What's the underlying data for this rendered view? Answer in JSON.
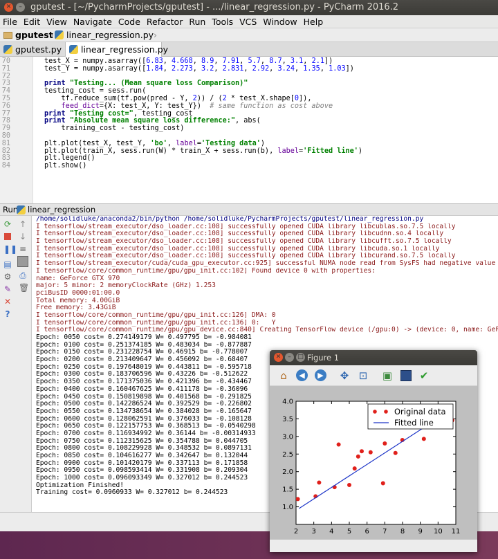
{
  "window": {
    "title": "gputest - [~/PycharmProjects/gputest] - .../linear_regression.py - PyCharm 2016.2"
  },
  "menu": [
    "File",
    "Edit",
    "View",
    "Navigate",
    "Code",
    "Refactor",
    "Run",
    "Tools",
    "VCS",
    "Window",
    "Help"
  ],
  "nav": {
    "project": "gputest",
    "file": "linear_regression.py"
  },
  "tabs": [
    {
      "label": "gputest.py",
      "active": false
    },
    {
      "label": "linear_regression.py",
      "active": true
    }
  ],
  "code_lines": [
    {
      "n": "70",
      "html": "test_X = numpy.asarray([<span class=\"num\">6.83</span>, <span class=\"num\">4.668</span>, <span class=\"num\">8.9</span>, <span class=\"num\">7.91</span>, <span class=\"num\">5.7</span>, <span class=\"num\">8.7</span>, <span class=\"num\">3.1</span>, <span class=\"num\">2.1</span>])"
    },
    {
      "n": "71",
      "html": "test_Y = numpy.asarray([<span class=\"num\">1.84</span>, <span class=\"num\">2.273</span>, <span class=\"num\">3.2</span>, <span class=\"num\">2.831</span>, <span class=\"num\">2.92</span>, <span class=\"num\">3.24</span>, <span class=\"num\">1.35</span>, <span class=\"num\">1.03</span>])"
    },
    {
      "n": "72",
      "html": ""
    },
    {
      "n": "73",
      "html": "<span class=\"kw\">print</span> <span class=\"str\">\"Testing... (Mean square loss Comparison)\"</span>"
    },
    {
      "n": "74",
      "html": "testing_cost = sess.run("
    },
    {
      "n": "75",
      "html": "    tf.reduce_sum(tf.pow(pred - Y, <span class=\"num\">2</span>)) / (<span class=\"num\">2</span> * test_X.shape[<span class=\"num\">0</span>]),"
    },
    {
      "n": "76",
      "html": "    <span class=\"kwarg\">feed_dict</span>={X: test_X, Y: test_Y})  <span class=\"cmt\"># same function as cost above</span>"
    },
    {
      "n": "77",
      "html": "<span class=\"kw\">print</span> <span class=\"str\">\"Testing cost=\"</span>, testing_cost"
    },
    {
      "n": "78",
      "html": "<span class=\"kw\">print</span> <span class=\"str\">\"Absolute mean square loss difference:\"</span>, abs("
    },
    {
      "n": "79",
      "html": "    training_cost - testing_cost)"
    },
    {
      "n": "80",
      "html": ""
    },
    {
      "n": "81",
      "html": "plt.plot(test_X, test_Y, <span class=\"str\">'bo'</span>, <span class=\"kwarg\">label</span>=<span class=\"str\">'Testing data'</span>)"
    },
    {
      "n": "82",
      "html": "plt.plot(train_X, sess.run(W) * train_X + sess.run(b), <span class=\"kwarg\">label</span>=<span class=\"str\">'Fitted line'</span>)"
    },
    {
      "n": "83",
      "html": "plt.legend()"
    },
    {
      "n": "84",
      "html": "plt.show()"
    }
  ],
  "run": {
    "label": "Run",
    "config": "linear_regression"
  },
  "console": [
    {
      "c": "path",
      "t": "/home/solidluke/anaconda2/bin/python /home/solidluke/PycharmProjects/gputest/linear_regression.py"
    },
    {
      "c": "log",
      "t": "I tensorflow/stream_executor/dso_loader.cc:108] successfully opened CUDA library libcublas.so.7.5 locally"
    },
    {
      "c": "log",
      "t": "I tensorflow/stream_executor/dso_loader.cc:108] successfully opened CUDA library libcudnn.so.4 locally"
    },
    {
      "c": "log",
      "t": "I tensorflow/stream_executor/dso_loader.cc:108] successfully opened CUDA library libcufft.so.7.5 locally"
    },
    {
      "c": "log",
      "t": "I tensorflow/stream_executor/dso_loader.cc:108] successfully opened CUDA library libcuda.so.1 locally"
    },
    {
      "c": "log",
      "t": "I tensorflow/stream_executor/dso_loader.cc:108] successfully opened CUDA library libcurand.so.7.5 locally"
    },
    {
      "c": "log",
      "t": "I tensorflow/stream_executor/cuda/cuda_gpu_executor.cc:925] successful NUMA node read from SysFS had negative value (-1), but the"
    },
    {
      "c": "log",
      "t": "I tensorflow/core/common_runtime/gpu/gpu_init.cc:102] Found device 0 with properties:"
    },
    {
      "c": "log",
      "t": "name: GeForce GTX 970"
    },
    {
      "c": "log",
      "t": "major: 5 minor: 2 memoryClockRate (GHz) 1.253"
    },
    {
      "c": "log",
      "t": "pciBusID 0000:01:00.0"
    },
    {
      "c": "log",
      "t": "Total memory: 4.00GiB"
    },
    {
      "c": "log",
      "t": "Free memory: 3.43GiB"
    },
    {
      "c": "log",
      "t": "I tensorflow/core/common_runtime/gpu/gpu_init.cc:126] DMA: 0"
    },
    {
      "c": "log",
      "t": "I tensorflow/core/common_runtime/gpu/gpu_init.cc:136] 0:   Y"
    },
    {
      "c": "log",
      "t": "I tensorflow/core/common_runtime/gpu/gpu_device.cc:840] Creating TensorFlow device (/gpu:0) -> (device: 0, name: GeForce GTX 970,"
    },
    {
      "c": "out",
      "t": "Epoch: 0050 cost= 0.274149179 W= 0.497795 b= -0.984081"
    },
    {
      "c": "out",
      "t": "Epoch: 0100 cost= 0.251374185 W= 0.483034 b= -0.877887"
    },
    {
      "c": "out",
      "t": "Epoch: 0150 cost= 0.231228754 W= 0.46915 b= -0.778007"
    },
    {
      "c": "out",
      "t": "Epoch: 0200 cost= 0.213409647 W= 0.456092 b= -0.68407"
    },
    {
      "c": "out",
      "t": "Epoch: 0250 cost= 0.197648019 W= 0.443811 b= -0.595718"
    },
    {
      "c": "out",
      "t": "Epoch: 0300 cost= 0.183706596 W= 0.43226 b= -0.512622"
    },
    {
      "c": "out",
      "t": "Epoch: 0350 cost= 0.171375036 W= 0.421396 b= -0.434467"
    },
    {
      "c": "out",
      "t": "Epoch: 0400 cost= 0.160467625 W= 0.411178 b= -0.36096"
    },
    {
      "c": "out",
      "t": "Epoch: 0450 cost= 0.150819898 W= 0.401568 b= -0.291825"
    },
    {
      "c": "out",
      "t": "Epoch: 0500 cost= 0.142286524 W= 0.392529 b= -0.226802"
    },
    {
      "c": "out",
      "t": "Epoch: 0550 cost= 0.134738654 W= 0.384028 b= -0.165647"
    },
    {
      "c": "out",
      "t": "Epoch: 0600 cost= 0.128062591 W= 0.376033 b= -0.108128"
    },
    {
      "c": "out",
      "t": "Epoch: 0650 cost= 0.122157753 W= 0.368513 b= -0.0540298"
    },
    {
      "c": "out",
      "t": "Epoch: 0700 cost= 0.116934992 W= 0.36144 b= -0.00314933"
    },
    {
      "c": "out",
      "t": "Epoch: 0750 cost= 0.112315625 W= 0.354788 b= 0.044705"
    },
    {
      "c": "out",
      "t": "Epoch: 0800 cost= 0.108229928 W= 0.348532 b= 0.0897131"
    },
    {
      "c": "out",
      "t": "Epoch: 0850 cost= 0.104616277 W= 0.342647 b= 0.132044"
    },
    {
      "c": "out",
      "t": "Epoch: 0900 cost= 0.101420179 W= 0.337113 b= 0.171858"
    },
    {
      "c": "out",
      "t": "Epoch: 0950 cost= 0.098593414 W= 0.331908 b= 0.209304"
    },
    {
      "c": "out",
      "t": "Epoch: 1000 cost= 0.096093349 W= 0.327012 b= 0.244523"
    },
    {
      "c": "out",
      "t": "Optimization Finished!"
    },
    {
      "c": "out",
      "t": "Training cost= 0.0960933 W= 0.327012 b= 0.244523"
    }
  ],
  "figure": {
    "title": "Figure 1",
    "toolbar": [
      "home-icon",
      "back-icon",
      "forward-icon",
      "pan-icon",
      "zoom-icon",
      "subplots-icon",
      "save-icon",
      "check-icon"
    ]
  },
  "chart_data": {
    "type": "scatter",
    "title": "",
    "xlabel": "",
    "ylabel": "",
    "xlim": [
      2,
      11
    ],
    "ylim": [
      0.5,
      4.0
    ],
    "xticks": [
      "2",
      "3",
      "4",
      "5",
      "6",
      "7",
      "8",
      "9",
      "10",
      "11"
    ],
    "yticks": [
      "1.0",
      "1.5",
      "2.0",
      "2.5",
      "3.0",
      "3.5",
      "4.0"
    ],
    "legend_position": "top-right",
    "series": [
      {
        "name": "Original data",
        "kind": "points",
        "color": "#e0201b",
        "x": [
          2.1,
          3.1,
          3.3,
          4.17,
          4.4,
          5.0,
          5.3,
          5.5,
          5.7,
          6.2,
          6.9,
          7.0,
          7.6,
          7.99,
          9.2,
          10.8
        ],
        "y": [
          1.22,
          1.3,
          1.69,
          1.56,
          2.77,
          1.62,
          2.09,
          2.43,
          2.58,
          2.55,
          1.67,
          2.8,
          2.53,
          2.9,
          2.93,
          3.46
        ]
      },
      {
        "name": "Fitted line",
        "kind": "line",
        "color": "#1d35c8",
        "x": [
          2.167,
          10.791
        ],
        "y": [
          0.953,
          3.773
        ]
      }
    ]
  }
}
